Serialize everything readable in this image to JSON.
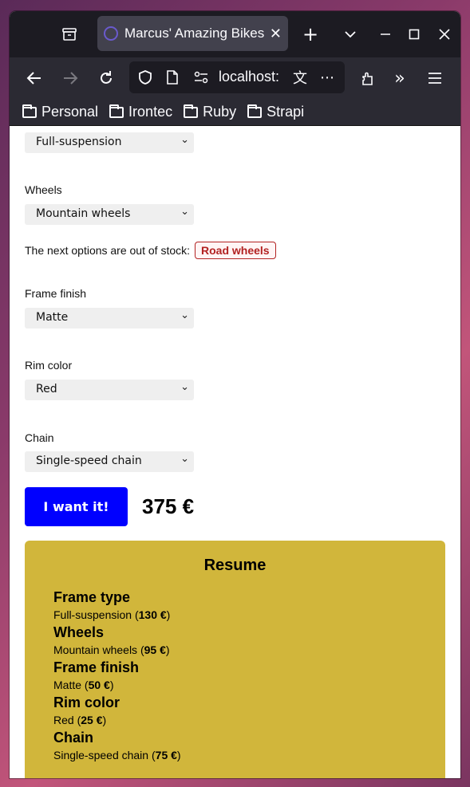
{
  "browser": {
    "tab_title": "Marcus' Amazing Bikes",
    "url": "localhost:",
    "bookmarks": [
      "Personal",
      "Irontec",
      "Ruby",
      "Strapi"
    ]
  },
  "form": {
    "frame_type": {
      "value": "Full-suspension"
    },
    "wheels": {
      "label": "Wheels",
      "value": "Mountain wheels"
    },
    "out_of_stock": {
      "text": "The next options are out of stock:",
      "items": [
        "Road wheels"
      ]
    },
    "frame_finish": {
      "label": "Frame finish",
      "value": "Matte"
    },
    "rim_color": {
      "label": "Rim color",
      "value": "Red"
    },
    "chain": {
      "label": "Chain",
      "value": "Single-speed chain"
    },
    "cta_label": "I want it!",
    "total_price": "375 €"
  },
  "resume": {
    "title": "Resume",
    "items": [
      {
        "title": "Frame type",
        "option": "Full-suspension",
        "price": "130 €"
      },
      {
        "title": "Wheels",
        "option": "Mountain wheels",
        "price": "95 €"
      },
      {
        "title": "Frame finish",
        "option": "Matte",
        "price": "50 €"
      },
      {
        "title": "Rim color",
        "option": "Red",
        "price": "25 €"
      },
      {
        "title": "Chain",
        "option": "Single-speed chain",
        "price": "75 €"
      }
    ]
  },
  "colors": {
    "accent_button": "#0000ff",
    "resume_bg": "#d1b63b",
    "out_of_stock": "#b22222"
  }
}
